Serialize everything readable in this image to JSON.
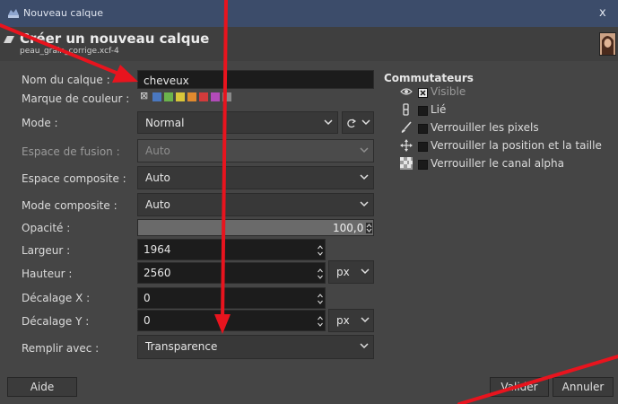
{
  "window": {
    "title": "Nouveau calque",
    "close": "x"
  },
  "header": {
    "title": "Créer un nouveau calque",
    "subtitle": "peau_grain_corrige.xcf-4"
  },
  "form": {
    "name": {
      "label": "Nom du calque :",
      "value": "cheveux"
    },
    "color_tag": {
      "label": "Marque de couleur :",
      "none_glyph": "⊠",
      "colors": [
        "#4a78c0",
        "#6cb34c",
        "#d9c63a",
        "#e08a2e",
        "#d23b3b",
        "#b24bb8",
        "#8a8a8a"
      ]
    },
    "mode": {
      "label": "Mode :",
      "value": "Normal"
    },
    "blend_space": {
      "label": "Espace de fusion :",
      "value": "Auto"
    },
    "composite_space": {
      "label": "Espace composite :",
      "value": "Auto"
    },
    "composite_mode": {
      "label": "Mode composite :",
      "value": "Auto"
    },
    "opacity": {
      "label": "Opacité :",
      "value": "100,0"
    },
    "width": {
      "label": "Largeur :",
      "value": "1964"
    },
    "height": {
      "label": "Hauteur :",
      "value": "2560"
    },
    "size_unit": "px",
    "offset_x": {
      "label": "Décalage X :",
      "value": "0"
    },
    "offset_y": {
      "label": "Décalage Y :",
      "value": "0"
    },
    "offset_unit": "px",
    "fill": {
      "label": "Remplir avec :",
      "value": "Transparence"
    }
  },
  "switches": {
    "title": "Commutateurs",
    "items": [
      {
        "label": "Visible",
        "icon": "eye-icon",
        "checked": true
      },
      {
        "label": "Lié",
        "icon": "chain-icon",
        "checked": false
      },
      {
        "label": "Verrouiller les pixels",
        "icon": "brush-icon",
        "checked": false
      },
      {
        "label": "Verrouiller la position et la taille",
        "icon": "move-icon",
        "checked": false
      },
      {
        "label": "Verrouiller le canal alpha",
        "icon": "checker-icon",
        "checked": false
      }
    ]
  },
  "buttons": {
    "help": "Aide",
    "ok": "Valider",
    "cancel": "Annuler"
  },
  "colors": {
    "annotation_arrow": "#e8141e",
    "titlebar": "#3c4c6a",
    "dialog_bg": "#454545"
  }
}
